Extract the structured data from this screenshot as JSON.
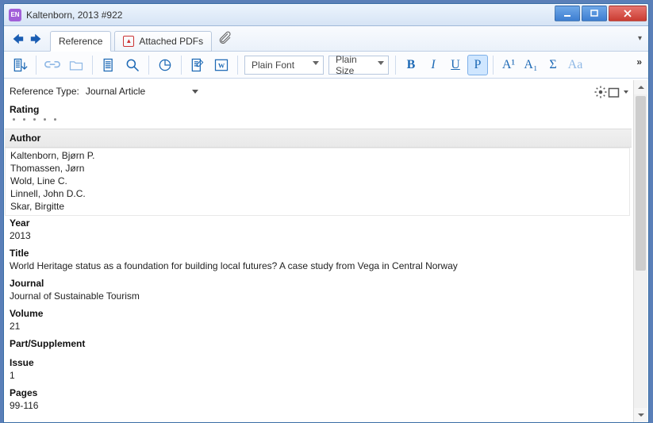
{
  "window": {
    "app_badge": "EN",
    "title": "Kaltenborn, 2013 #922"
  },
  "tabs": {
    "reference": "Reference",
    "attached_pdfs": "Attached PDFs"
  },
  "toolbar": {
    "font_combo": "Plain Font",
    "size_combo": "Plain Size",
    "bold": "B",
    "italic": "I",
    "underline": "U",
    "plain": "P",
    "superscript": "A¹",
    "subscript": "A₁",
    "sigma": "Σ",
    "case": "Aa"
  },
  "reference": {
    "type_label": "Reference Type:",
    "type_value": "Journal Article",
    "rating_label": "Rating",
    "author_label": "Author",
    "authors": [
      "Kaltenborn, Bjørn P.",
      "Thomassen, Jørn",
      "Wold, Line C.",
      "Linnell, John D.C.",
      "Skar, Birgitte"
    ],
    "year_label": "Year",
    "year_value": "2013",
    "title_label": "Title",
    "title_value": "World Heritage status as a foundation for building local futures? A case study from Vega in Central Norway",
    "journal_label": "Journal",
    "journal_value": "Journal of Sustainable Tourism",
    "volume_label": "Volume",
    "volume_value": "21",
    "part_label": "Part/Supplement",
    "part_value": "",
    "issue_label": "Issue",
    "issue_value": "1",
    "pages_label": "Pages",
    "pages_value": "99-116"
  }
}
